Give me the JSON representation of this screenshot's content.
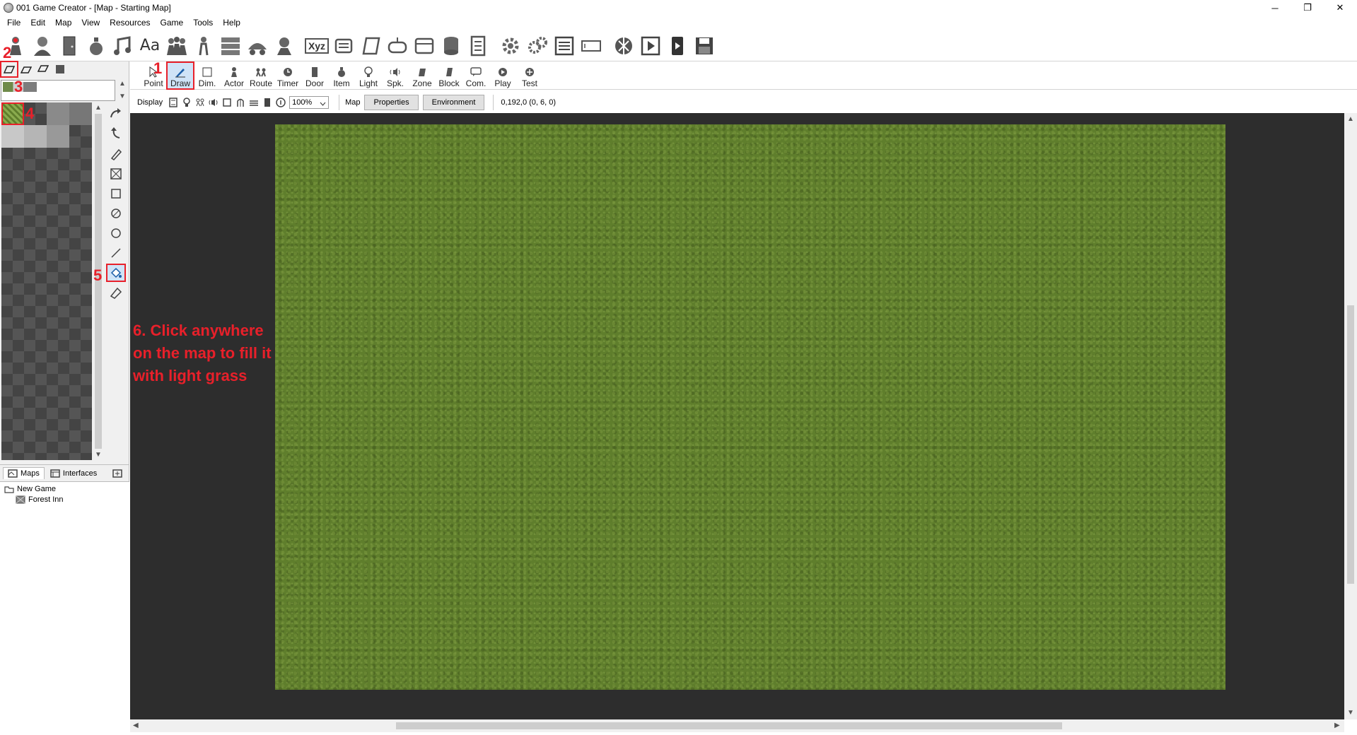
{
  "window": {
    "title": "001 Game Creator - [Map - Starting Map]",
    "controls": {
      "minimize": "─",
      "restore": "❐",
      "close": "✕"
    }
  },
  "menu": [
    "File",
    "Edit",
    "Map",
    "View",
    "Resources",
    "Game",
    "Tools",
    "Help"
  ],
  "main_toolbar": {
    "icons": [
      "player-icon",
      "character-icon",
      "door-icon",
      "potion-icon",
      "music-icon",
      "font-icon",
      "group-icon",
      "figure-icon",
      "list-icon",
      "vehicle-icon",
      "npc-icon",
      "xyz-icon",
      "scroll-icon",
      "notes-icon",
      "gamepad-icon",
      "database-icon",
      "storage-icon",
      "file-icon",
      "gear-icon",
      "gears-icon",
      "menu-list-icon",
      "input-box-icon",
      "export-icon",
      "play-video-icon",
      "phone-icon",
      "save-icon"
    ],
    "xyz_label": "Xyz",
    "font_label": "Aa"
  },
  "map_toolbar": [
    {
      "label": "Point",
      "icon": "cursor-icon"
    },
    {
      "label": "Draw",
      "icon": "pencil-icon"
    },
    {
      "label": "Dim.",
      "icon": "square-icon"
    },
    {
      "label": "Actor",
      "icon": "actor-icon"
    },
    {
      "label": "Route",
      "icon": "route-icon"
    },
    {
      "label": "Timer",
      "icon": "timer-icon"
    },
    {
      "label": "Door",
      "icon": "door-icon"
    },
    {
      "label": "Item",
      "icon": "bag-icon"
    },
    {
      "label": "Light",
      "icon": "bulb-icon"
    },
    {
      "label": "Spk.",
      "icon": "speaker-icon"
    },
    {
      "label": "Zone",
      "icon": "zone-icon"
    },
    {
      "label": "Block",
      "icon": "block-icon"
    },
    {
      "label": "Com.",
      "icon": "comment-icon"
    },
    {
      "label": "Play",
      "icon": "play-icon"
    },
    {
      "label": "Test",
      "icon": "test-icon"
    }
  ],
  "display_bar": {
    "label": "Display",
    "zoom": "100%",
    "map_label": "Map",
    "properties": "Properties",
    "environment": "Environment",
    "coords": "0,192,0 (0, 6, 0)"
  },
  "left_panel": {
    "tabs": {
      "maps": "Maps",
      "interfaces": "Interfaces"
    },
    "tree": {
      "root": "New Game",
      "child": "Forest Inn"
    }
  },
  "annotations": {
    "m1": "1",
    "m2": "2",
    "m3": "3",
    "m4": "4",
    "m5": "5",
    "step6": "6. Click anywhere on the map to fill it with light grass"
  },
  "colors": {
    "accent_red": "#e8202a",
    "grass": "#5f7e2c",
    "map_background": "#2d2d2d",
    "selected": "#cfe3f7"
  }
}
